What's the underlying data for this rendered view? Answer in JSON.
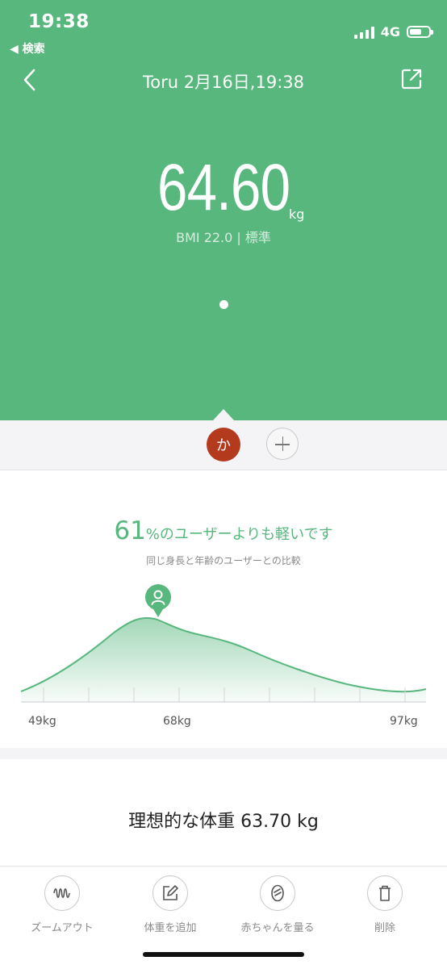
{
  "status_bar": {
    "time": "19:38",
    "back_app": "◀ 検索",
    "network": "4G"
  },
  "nav": {
    "title": "Toru 2月16日,19:38",
    "back_icon": "chevron-left-icon",
    "share_icon": "share-icon"
  },
  "hero": {
    "weight": "64.60",
    "unit": "kg",
    "bmi": "BMI 22.0 | 標準",
    "bg_color": "#57b77d"
  },
  "user_bar": {
    "avatar_label": "か",
    "avatar_color": "#b43a1e"
  },
  "comparison": {
    "percent": "61",
    "headline": "%のユーザーよりも軽いです",
    "subtitle": "同じ身長と年齢のユーザーとの比較",
    "axis_labels": [
      "49kg",
      "68kg",
      "97kg"
    ]
  },
  "ideal": {
    "text": "理想的な体重 63.70 kg"
  },
  "toolbar": [
    {
      "label": "ズームアウト",
      "icon": "waveform-icon"
    },
    {
      "label": "体重を追加",
      "icon": "edit-icon"
    },
    {
      "label": "赤ちゃんを量る",
      "icon": "baby-icon"
    },
    {
      "label": "削除",
      "icon": "trash-icon"
    }
  ]
}
